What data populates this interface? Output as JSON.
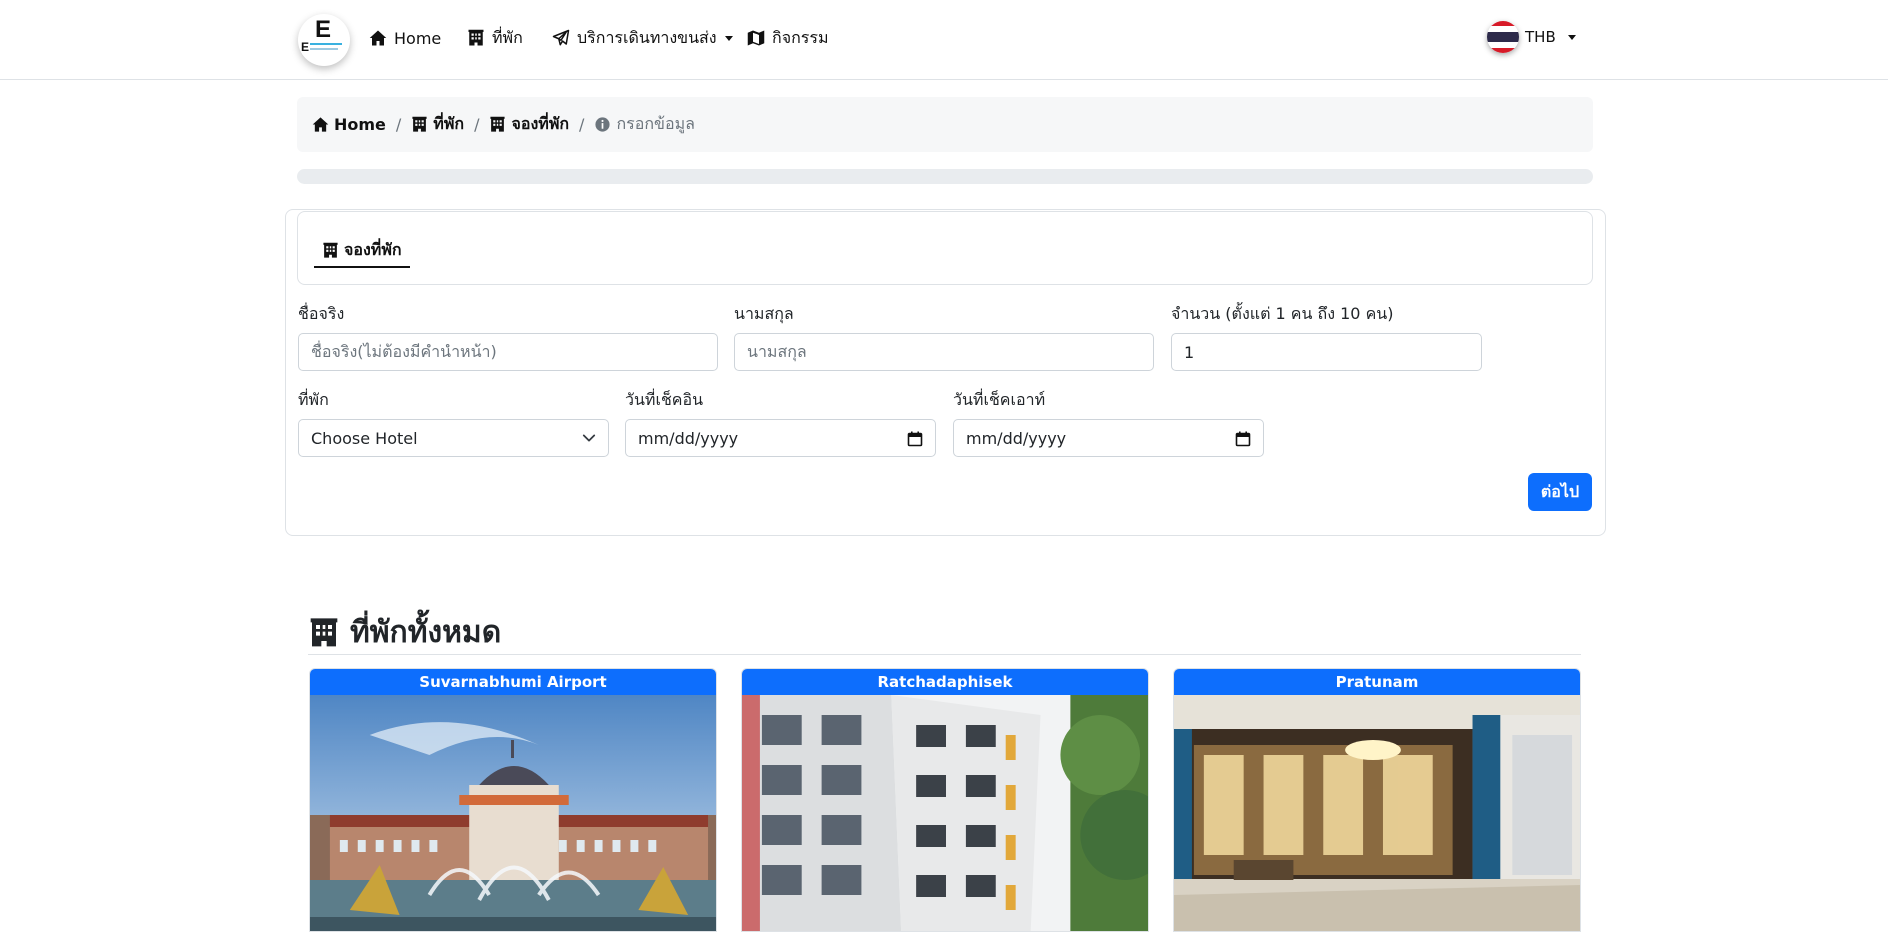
{
  "navbar": {
    "logo_text": "E",
    "items": [
      {
        "label": "Home",
        "icon": "home-icon"
      },
      {
        "label": "ที่พัก",
        "icon": "hotel-icon"
      },
      {
        "label": "บริการเดินทางขนส่ง",
        "icon": "paper-plane-icon",
        "dropdown": true
      },
      {
        "label": "กิจกรรม",
        "icon": "map-icon"
      }
    ],
    "currency": {
      "label": "THB",
      "flag": "thailand-flag-icon"
    }
  },
  "breadcrumb": [
    {
      "label": "Home",
      "icon": "home-icon"
    },
    {
      "label": "ที่พัก",
      "icon": "hotel-icon"
    },
    {
      "label": "จองที่พัก",
      "icon": "hotel-icon"
    },
    {
      "label": "กรอกข้อมูล",
      "icon": "info-circle-icon",
      "active": true
    }
  ],
  "progress": {
    "value_percent": 0
  },
  "form": {
    "tab_label": "จองที่พัก",
    "first_name": {
      "label": "ชื่อจริง",
      "placeholder": "ชื่อจริง(ไม่ต้องมีคำนำหน้า)",
      "value": ""
    },
    "last_name": {
      "label": "นามสกุล",
      "placeholder": "นามสกุล",
      "value": ""
    },
    "guests": {
      "label": "จำนวน (ตั้งแต่ 1 คน ถึง 10 คน)",
      "value": "1"
    },
    "hotel": {
      "label": "ที่พัก",
      "selected": "Choose Hotel"
    },
    "check_in": {
      "label": "วันที่เช็คอิน",
      "placeholder": "mm/dd/yyyy"
    },
    "check_out": {
      "label": "วันที่เช็คเอาท์",
      "placeholder": "mm/dd/yyyy"
    },
    "next_button": "ต่อไป"
  },
  "hotels_section": {
    "title": "ที่พักทั้งหมด",
    "hotels": [
      {
        "name": "Suvarnabhumi Airport"
      },
      {
        "name": "Ratchadaphisek"
      },
      {
        "name": "Pratunam"
      }
    ]
  },
  "colors": {
    "primary": "#0d6efd",
    "breadcrumb_bg": "#f6f7f8",
    "border": "#dee2e6"
  }
}
